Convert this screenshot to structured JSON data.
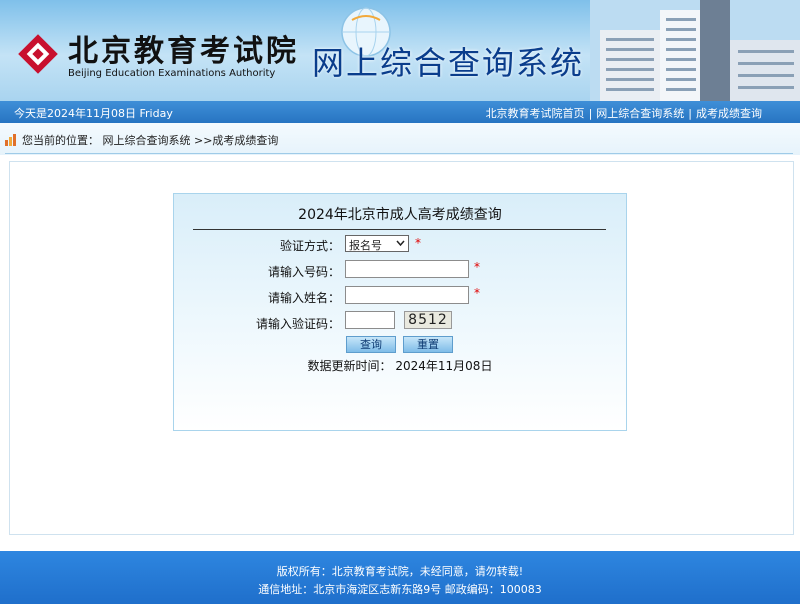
{
  "header": {
    "org_name_cn": "北京教育考试院",
    "org_name_en": "Beijing Education Examinations Authority",
    "system_title": "网上综合查询系统"
  },
  "topbar": {
    "date_text": "今天是2024年11月08日 Friday",
    "links": [
      "北京教育考试院首页",
      "网上综合查询系统",
      "成考成绩查询"
    ],
    "separator": "|"
  },
  "breadcrumb": {
    "prefix": "您当前的位置：",
    "path": "网上综合查询系统 >>成考成绩查询"
  },
  "form": {
    "title": "2024年北京市成人高考成绩查询",
    "verify_label": "验证方式：",
    "verify_selected": "报名号",
    "number_label": "请输入号码：",
    "number_value": "",
    "name_label": "请输入姓名：",
    "name_value": "",
    "captcha_label": "请输入验证码：",
    "captcha_value": "",
    "captcha_image_text": "8512",
    "required_mark": "*",
    "query_button": "查询",
    "reset_button": "重置",
    "update_text": "数据更新时间：  2024年11月08日"
  },
  "footer": {
    "copyright": "版权所有：北京教育考试院，未经同意，请勿转载!",
    "address": "通信地址：北京市海淀区志新东路9号 邮政编码：100083"
  },
  "colors": {
    "banner_title": "#0a3d8c",
    "bar_blue": "#2774c2",
    "required": "#e00000",
    "logo_red": "#c8102e"
  },
  "icons": [
    "logo-mark-icon",
    "globe-icon",
    "breadcrumb-icon",
    "chevron-down-icon"
  ]
}
